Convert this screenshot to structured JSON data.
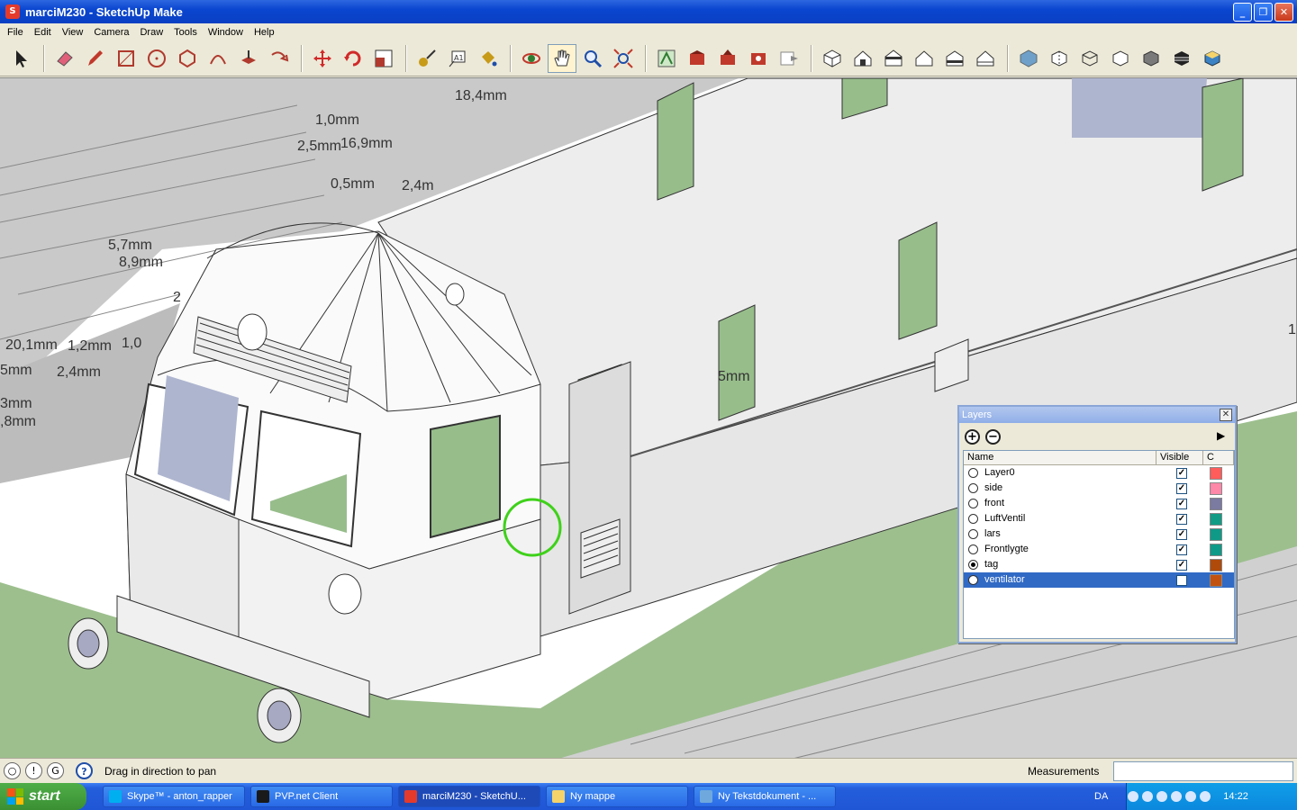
{
  "window": {
    "title": "marciM230 - SketchUp Make",
    "buttons": {
      "minimize": "_",
      "maximize": "❐",
      "close": "✕"
    }
  },
  "menu": [
    "File",
    "Edit",
    "View",
    "Camera",
    "Draw",
    "Tools",
    "Window",
    "Help"
  ],
  "toolbar": {
    "tools": [
      {
        "name": "select-tool",
        "icon": "arrow-icon",
        "color": "#222222"
      },
      {
        "name": "eraser-tool",
        "icon": "eraser-icon",
        "color": "#e0607a"
      },
      {
        "name": "line-tool",
        "icon": "pencil-icon",
        "color": "#c0392b"
      },
      {
        "name": "rectangle-tool",
        "icon": "rectangle-icon",
        "color": "#b03a2e"
      },
      {
        "name": "circle-tool",
        "icon": "circle-icon",
        "color": "#b03a2e"
      },
      {
        "name": "polygon-tool",
        "icon": "polygon-icon",
        "color": "#b03a2e"
      },
      {
        "name": "arc-tool",
        "icon": "arc-icon",
        "color": "#b03a2e"
      },
      {
        "name": "pushpull-tool",
        "icon": "pushpull-icon",
        "color": "#b03a2e"
      },
      {
        "name": "followme-tool",
        "icon": "followme-icon",
        "color": "#b03a2e"
      },
      {
        "name": "move-tool",
        "icon": "move-icon",
        "color": "#d12a2a"
      },
      {
        "name": "rotate-tool",
        "icon": "rotate-icon",
        "color": "#d12a2a"
      },
      {
        "name": "scale-tool",
        "icon": "scale-icon",
        "color": "#b03a2e"
      },
      {
        "name": "tape-measure-tool",
        "icon": "tape-icon",
        "color": "#c79a18"
      },
      {
        "name": "text-tool",
        "icon": "text-icon",
        "color": "#333333"
      },
      {
        "name": "paint-bucket-tool",
        "icon": "paint-icon",
        "color": "#c79a18"
      },
      {
        "name": "orbit-tool",
        "icon": "orbit-icon",
        "color": "#c0392b"
      },
      {
        "name": "pan-tool",
        "icon": "hand-icon",
        "color": "#333333",
        "active": true
      },
      {
        "name": "zoom-tool",
        "icon": "zoom-icon",
        "color": "#1f4ea8"
      },
      {
        "name": "zoom-extents-tool",
        "icon": "zoom-extents-icon",
        "color": "#c0392b"
      },
      {
        "name": "add-location-tool",
        "icon": "map-icon",
        "color": "#2e7d32"
      },
      {
        "name": "get-models-tool",
        "icon": "warehouse-icon",
        "color": "#c0392b"
      },
      {
        "name": "share-model-tool",
        "icon": "share-icon",
        "color": "#c0392b"
      },
      {
        "name": "extension-warehouse-tool",
        "icon": "extension-icon",
        "color": "#c0392b"
      },
      {
        "name": "send-to-layout-tool",
        "icon": "layout-icon",
        "color": "#888888"
      },
      {
        "name": "view-iso",
        "icon": "iso-view-icon",
        "color": "#333333"
      },
      {
        "name": "view-top",
        "icon": "top-view-icon",
        "color": "#333333"
      },
      {
        "name": "view-front",
        "icon": "front-view-icon",
        "color": "#333333"
      },
      {
        "name": "view-right",
        "icon": "right-view-icon",
        "color": "#333333"
      },
      {
        "name": "view-back",
        "icon": "back-view-icon",
        "color": "#333333"
      },
      {
        "name": "view-left",
        "icon": "left-view-icon",
        "color": "#333333"
      },
      {
        "name": "style-xray",
        "icon": "xray-icon",
        "color": "#3b82c4"
      },
      {
        "name": "style-backedges",
        "icon": "backedges-icon",
        "color": "#333333"
      },
      {
        "name": "style-wireframe",
        "icon": "wireframe-icon",
        "color": "#333333"
      },
      {
        "name": "style-hiddenline",
        "icon": "hiddenline-icon",
        "color": "#333333"
      },
      {
        "name": "style-shaded",
        "icon": "shaded-icon",
        "color": "#555555"
      },
      {
        "name": "style-shaded-textures",
        "icon": "textures-icon",
        "color": "#222222"
      },
      {
        "name": "style-monochrome",
        "icon": "monochrome-icon",
        "color": "#3b82c4"
      }
    ]
  },
  "viewport": {
    "dimensions": [
      "18,4mm",
      "1,0mm",
      "2,5mm",
      "16,9mm",
      "0,5mm",
      "2,4m",
      "5,7mm",
      "8,9mm",
      "2",
      "20,1mm",
      "1,2mm",
      "1,0",
      "5mm",
      "2,4mm",
      "3mm",
      ",8mm",
      "5mm",
      "1"
    ],
    "colors": {
      "ground": "#9dbf8e",
      "window_glass": "#97bd8b",
      "body": "#ededed",
      "edge": "#333333",
      "inference_circle": "#3fd11a"
    }
  },
  "layers": {
    "title": "Layers",
    "columns": {
      "name": "Name",
      "visible": "Visible",
      "color": "C"
    },
    "rows": [
      {
        "name": "Layer0",
        "visible": true,
        "active": false,
        "selected": false,
        "color": "#ff5c5c"
      },
      {
        "name": "side",
        "visible": true,
        "active": false,
        "selected": false,
        "color": "#ff88a8"
      },
      {
        "name": "front",
        "visible": true,
        "active": false,
        "selected": false,
        "color": "#7b7aa0"
      },
      {
        "name": "LuftVentil",
        "visible": true,
        "active": false,
        "selected": false,
        "color": "#119c85"
      },
      {
        "name": "lars",
        "visible": true,
        "active": false,
        "selected": false,
        "color": "#0f9a88"
      },
      {
        "name": "Frontlygte",
        "visible": true,
        "active": false,
        "selected": false,
        "color": "#0e9a88"
      },
      {
        "name": "tag",
        "visible": true,
        "active": true,
        "selected": false,
        "color": "#b04a0a"
      },
      {
        "name": "ventilator",
        "visible": false,
        "active": false,
        "selected": true,
        "color": "#c2520f"
      }
    ]
  },
  "status": {
    "text": "Drag in direction to pan",
    "measurements_label": "Measurements",
    "measurements_value": ""
  },
  "taskbar": {
    "start": "start",
    "tasks": [
      {
        "label": "Skype™ - anton_rapper",
        "icon_color": "#00aff0",
        "active": false
      },
      {
        "label": "PVP.net Client",
        "icon_color": "#1a1a1a",
        "active": false
      },
      {
        "label": "marciM230 - SketchU...",
        "icon_color": "#e43a2c",
        "active": true
      },
      {
        "label": "Ny mappe",
        "icon_color": "#f5d36b",
        "active": false
      },
      {
        "label": "Ny Tekstdokument - ...",
        "icon_color": "#6fa8dc",
        "active": false
      }
    ],
    "language": "DA",
    "clock": "14:22"
  }
}
